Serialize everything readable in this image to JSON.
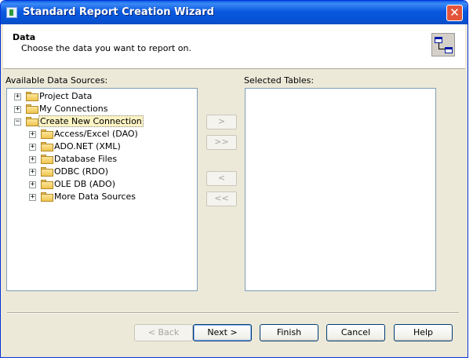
{
  "window": {
    "title": "Standard Report Creation Wizard",
    "close_label": "✕"
  },
  "header": {
    "title": "Data",
    "description": "Choose the data you want to report on."
  },
  "available": {
    "label": "Available Data Sources:",
    "items": [
      {
        "label": "Project Data",
        "expander": "+"
      },
      {
        "label": "My Connections",
        "expander": "+"
      },
      {
        "label": "Create New Connection",
        "expander": "−",
        "selected": true
      },
      {
        "label": "Access/Excel (DAO)",
        "expander": "+"
      },
      {
        "label": "ADO.NET (XML)",
        "expander": "+"
      },
      {
        "label": "Database Files",
        "expander": "+"
      },
      {
        "label": "ODBC (RDO)",
        "expander": "+"
      },
      {
        "label": "OLE DB (ADO)",
        "expander": "+"
      },
      {
        "label": "More Data Sources",
        "expander": "+"
      }
    ]
  },
  "selected": {
    "label": "Selected Tables:"
  },
  "move": {
    "add": ">",
    "add_all": ">>",
    "remove": "<",
    "remove_all": "<<"
  },
  "buttons": {
    "back": "< Back",
    "next": "Next >",
    "finish": "Finish",
    "cancel": "Cancel",
    "help": "Help"
  }
}
